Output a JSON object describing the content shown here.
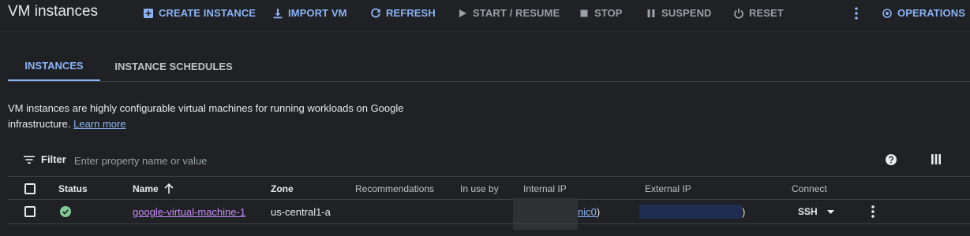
{
  "header": {
    "title": "VM instances",
    "create_label": "CREATE INSTANCE",
    "import_label": "IMPORT VM",
    "refresh_label": "REFRESH",
    "start_label": "START / RESUME",
    "stop_label": "STOP",
    "suspend_label": "SUSPEND",
    "reset_label": "RESET",
    "operations_label": "OPERATIONS"
  },
  "tabs": [
    {
      "label": "INSTANCES",
      "active": true
    },
    {
      "label": "INSTANCE SCHEDULES",
      "active": false
    }
  ],
  "description": {
    "text": "VM instances are highly configurable virtual machines for running workloads on Google infrastructure.",
    "link": "Learn more"
  },
  "filter": {
    "label": "Filter",
    "placeholder": "Enter property name or value"
  },
  "table": {
    "headers": {
      "status": "Status",
      "name": "Name",
      "zone": "Zone",
      "recommendations": "Recommendations",
      "in_use_by": "In use by",
      "internal_ip": "Internal IP",
      "external_ip": "External IP",
      "connect": "Connect"
    },
    "rows": [
      {
        "status": "running",
        "name": "google-virtual-machine-1",
        "zone": "us-central1-a",
        "internal_ip_suffix": "nic0",
        "internal_ip_close": ")",
        "external_ip_close": ")",
        "connect": "SSH"
      }
    ]
  },
  "colors": {
    "background": "#202124",
    "accent": "#8ab4f8",
    "link_visited": "#c58af9",
    "status_ok": "#81c995"
  }
}
